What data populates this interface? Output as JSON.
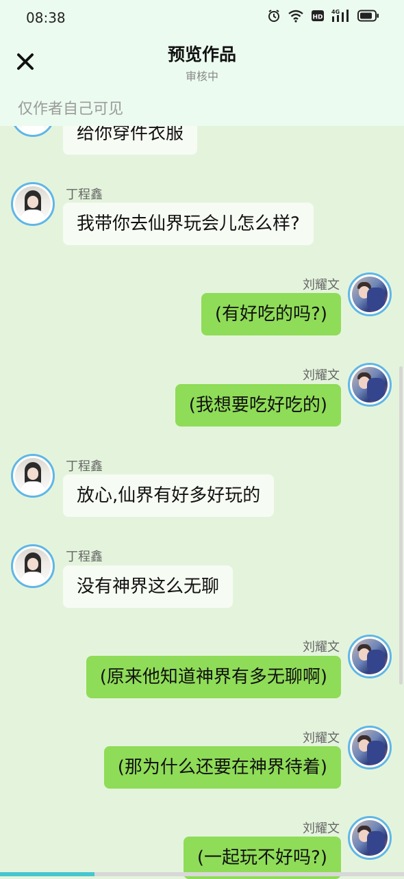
{
  "status_bar": {
    "time": "08:38",
    "icons": [
      "alarm-icon",
      "wifi-icon",
      "hd-icon",
      "4g-signal-icon",
      "battery-icon"
    ],
    "hd_label": "HD",
    "net_label": "4G"
  },
  "header": {
    "title": "预览作品",
    "subtitle": "审核中",
    "visibility": "仅作者自己可见",
    "close_icon": "close-icon"
  },
  "messages": [
    {
      "side": "left",
      "name": "",
      "text": "给你穿件衣服"
    },
    {
      "side": "left",
      "name": "丁程鑫",
      "text": "我带你去仙界玩会儿怎么样?"
    },
    {
      "side": "right",
      "name": "刘耀文",
      "text": "(有好吃的吗?)"
    },
    {
      "side": "right",
      "name": "刘耀文",
      "text": "(我想要吃好吃的)"
    },
    {
      "side": "left",
      "name": "丁程鑫",
      "text": "放心,仙界有好多好玩的"
    },
    {
      "side": "left",
      "name": "丁程鑫",
      "text": "没有神界这么无聊"
    },
    {
      "side": "right",
      "name": "刘耀文",
      "text": "(原来他知道神界有多无聊啊)"
    },
    {
      "side": "right",
      "name": "刘耀文",
      "text": "(那为什么还要在神界待着)"
    },
    {
      "side": "right",
      "name": "刘耀文",
      "text": "(一起玩不好吗?)"
    }
  ],
  "colors": {
    "background": "#e4f4dc",
    "header_bg": "#ecfbef",
    "right_bubble": "#8fdc58",
    "left_bubble": "#f6fbf3",
    "avatar_ring": "#5fb6e6"
  }
}
